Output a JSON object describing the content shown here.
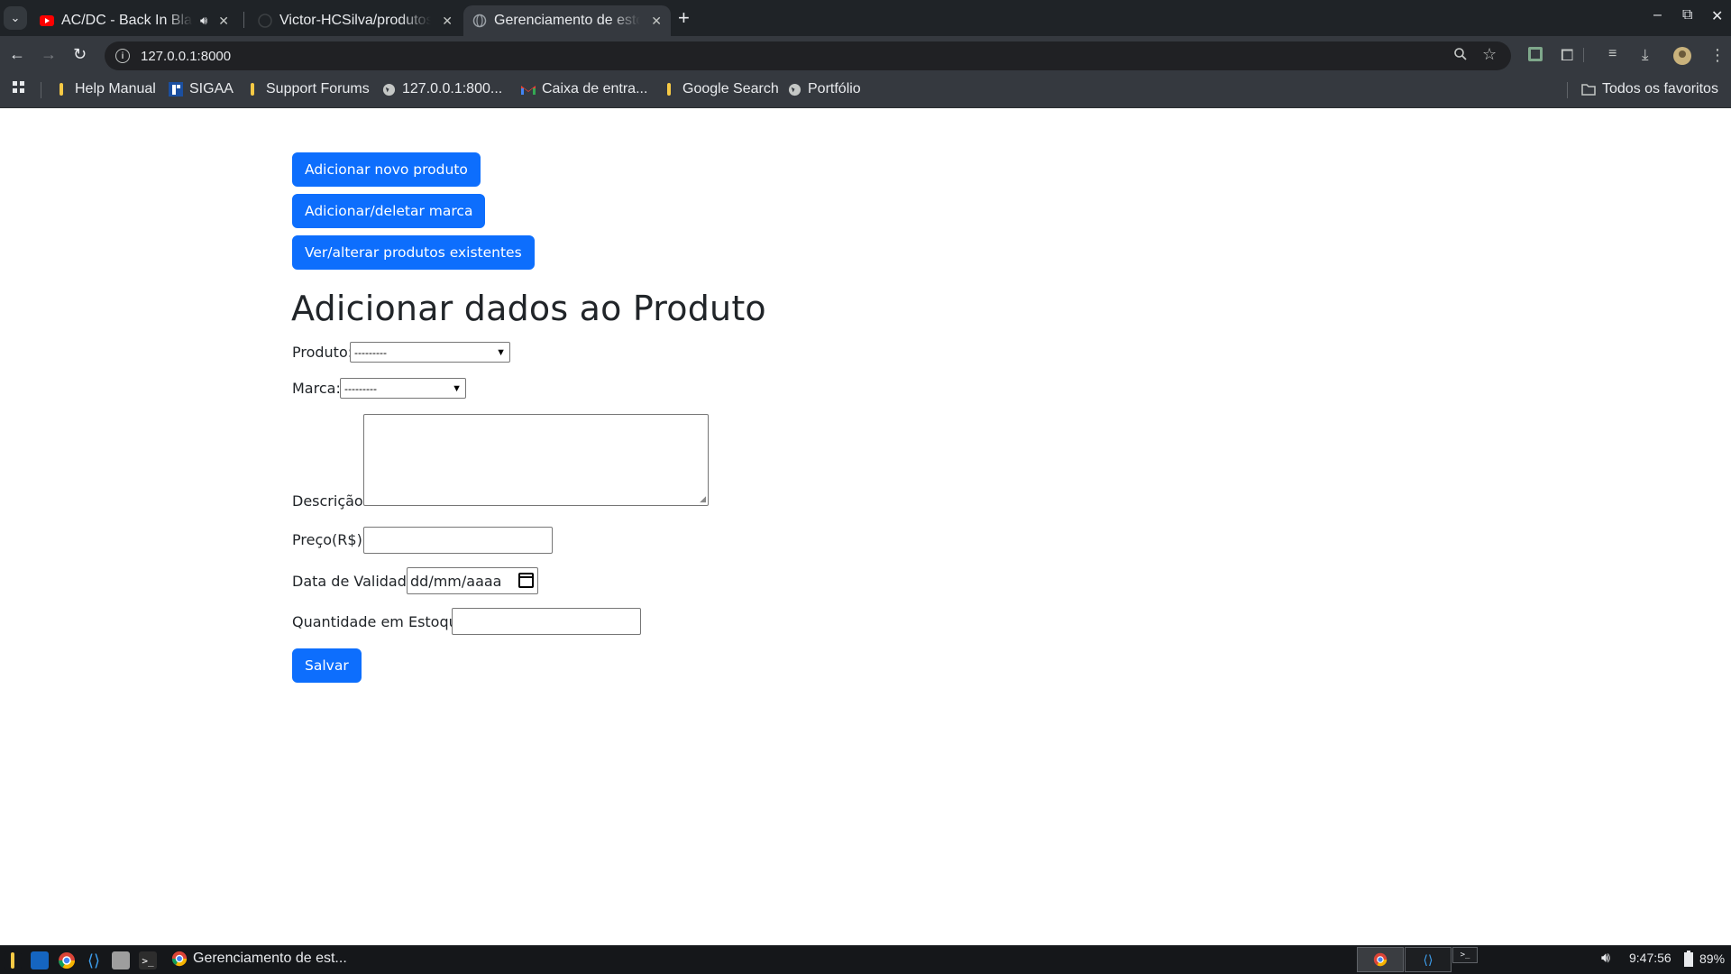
{
  "browser": {
    "tabs": [
      {
        "title": "AC/DC - Back In Black",
        "favicon": "youtube-icon",
        "audio": true
      },
      {
        "title": "Victor-HCSilva/produtos",
        "favicon": "github-icon",
        "audio": false
      },
      {
        "title": "Gerenciamento de estoque",
        "favicon": "globe-icon",
        "audio": false
      }
    ],
    "url": "127.0.0.1:8000",
    "bookmarks": [
      {
        "label": "Help Manual",
        "icon": "bookmark-bulb-icon"
      },
      {
        "label": "SIGAA",
        "icon": "sigaa-icon"
      },
      {
        "label": "Support Forums",
        "icon": "bookmark-bulb-icon"
      },
      {
        "label": "127.0.0.1:800...",
        "icon": "globe-icon"
      },
      {
        "label": "Caixa de entra...",
        "icon": "gmail-icon"
      },
      {
        "label": "Google Search",
        "icon": "bookmark-bulb-icon"
      },
      {
        "label": "Portfólio",
        "icon": "globe-icon"
      }
    ],
    "all_bookmarks": "Todos os favoritos"
  },
  "page": {
    "nav_buttons": [
      "Adicionar novo produto",
      "Adicionar/deletar marca",
      "Ver/alterar produtos existentes"
    ],
    "title": "Adicionar dados ao Produto",
    "form": {
      "produto_label": "Produto:",
      "produto_value": "---------",
      "marca_label": "Marca:",
      "marca_value": "---------",
      "descricao_label": "Descrição:",
      "preco_label": "Preço(R$):",
      "validade_label": "Data de Validade:",
      "validade_placeholder": "dd/mm/aaaa",
      "estoque_label": "Quantidade em Estoque:",
      "save_label": "Salvar"
    },
    "colors": {
      "primary": "#0d6efd"
    }
  },
  "taskbar": {
    "active_window": "Gerenciamento de est...",
    "time": "9:47:56",
    "battery": "89%"
  }
}
